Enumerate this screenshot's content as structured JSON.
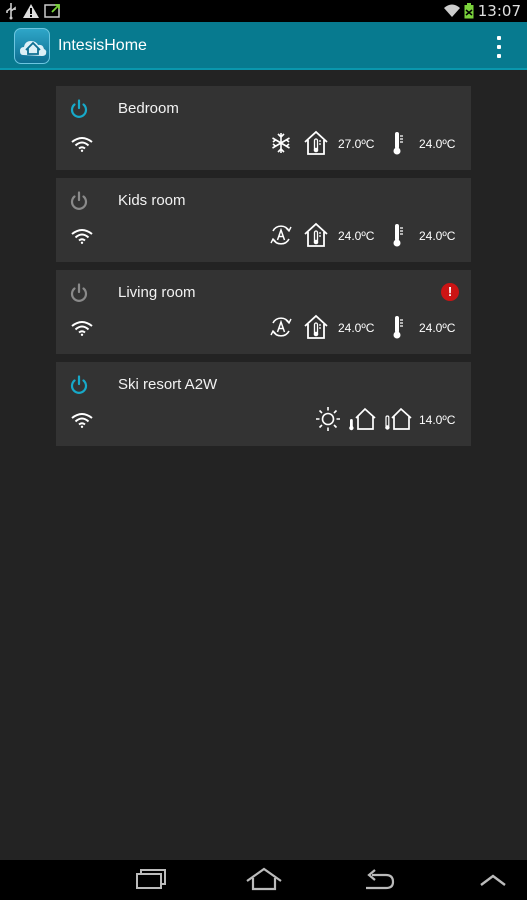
{
  "status_bar": {
    "time": "13:07",
    "left_icons": [
      "usb-icon",
      "warning-icon",
      "screen-mirror-icon"
    ],
    "right_icons": [
      "wifi-signal-icon",
      "battery-icon"
    ]
  },
  "action_bar": {
    "title": "IntesisHome",
    "menu_icon": "overflow-menu-icon"
  },
  "devices": [
    {
      "name": "Bedroom",
      "power_on": true,
      "mode": "cool",
      "mode_icon": "snowflake-icon",
      "setpoint": "27.0ºC",
      "room_temp": "24.0ºC",
      "alert": false
    },
    {
      "name": "Kids room",
      "power_on": false,
      "mode": "auto",
      "mode_icon": "auto-mode-icon",
      "setpoint": "24.0ºC",
      "room_temp": "24.0ºC",
      "alert": false
    },
    {
      "name": "Living room",
      "power_on": false,
      "mode": "auto",
      "mode_icon": "auto-mode-icon",
      "setpoint": "24.0ºC",
      "room_temp": "24.0ºC",
      "alert": true,
      "alert_text": "!"
    },
    {
      "name": "Ski resort A2W",
      "power_on": true,
      "mode": "heat",
      "mode_icon": "sun-icon",
      "outdoor_temp": "14.0ºC",
      "alert": false
    }
  ],
  "colors": {
    "power_on": "#17a9c9",
    "power_off": "#8a8a8a",
    "action_bar": "#077a8f",
    "card": "#333333",
    "background": "#232323",
    "alert": "#cc1414"
  },
  "navigation": {
    "buttons": [
      "recent-apps-icon",
      "home-icon",
      "back-icon",
      "up-arrow-icon"
    ]
  }
}
